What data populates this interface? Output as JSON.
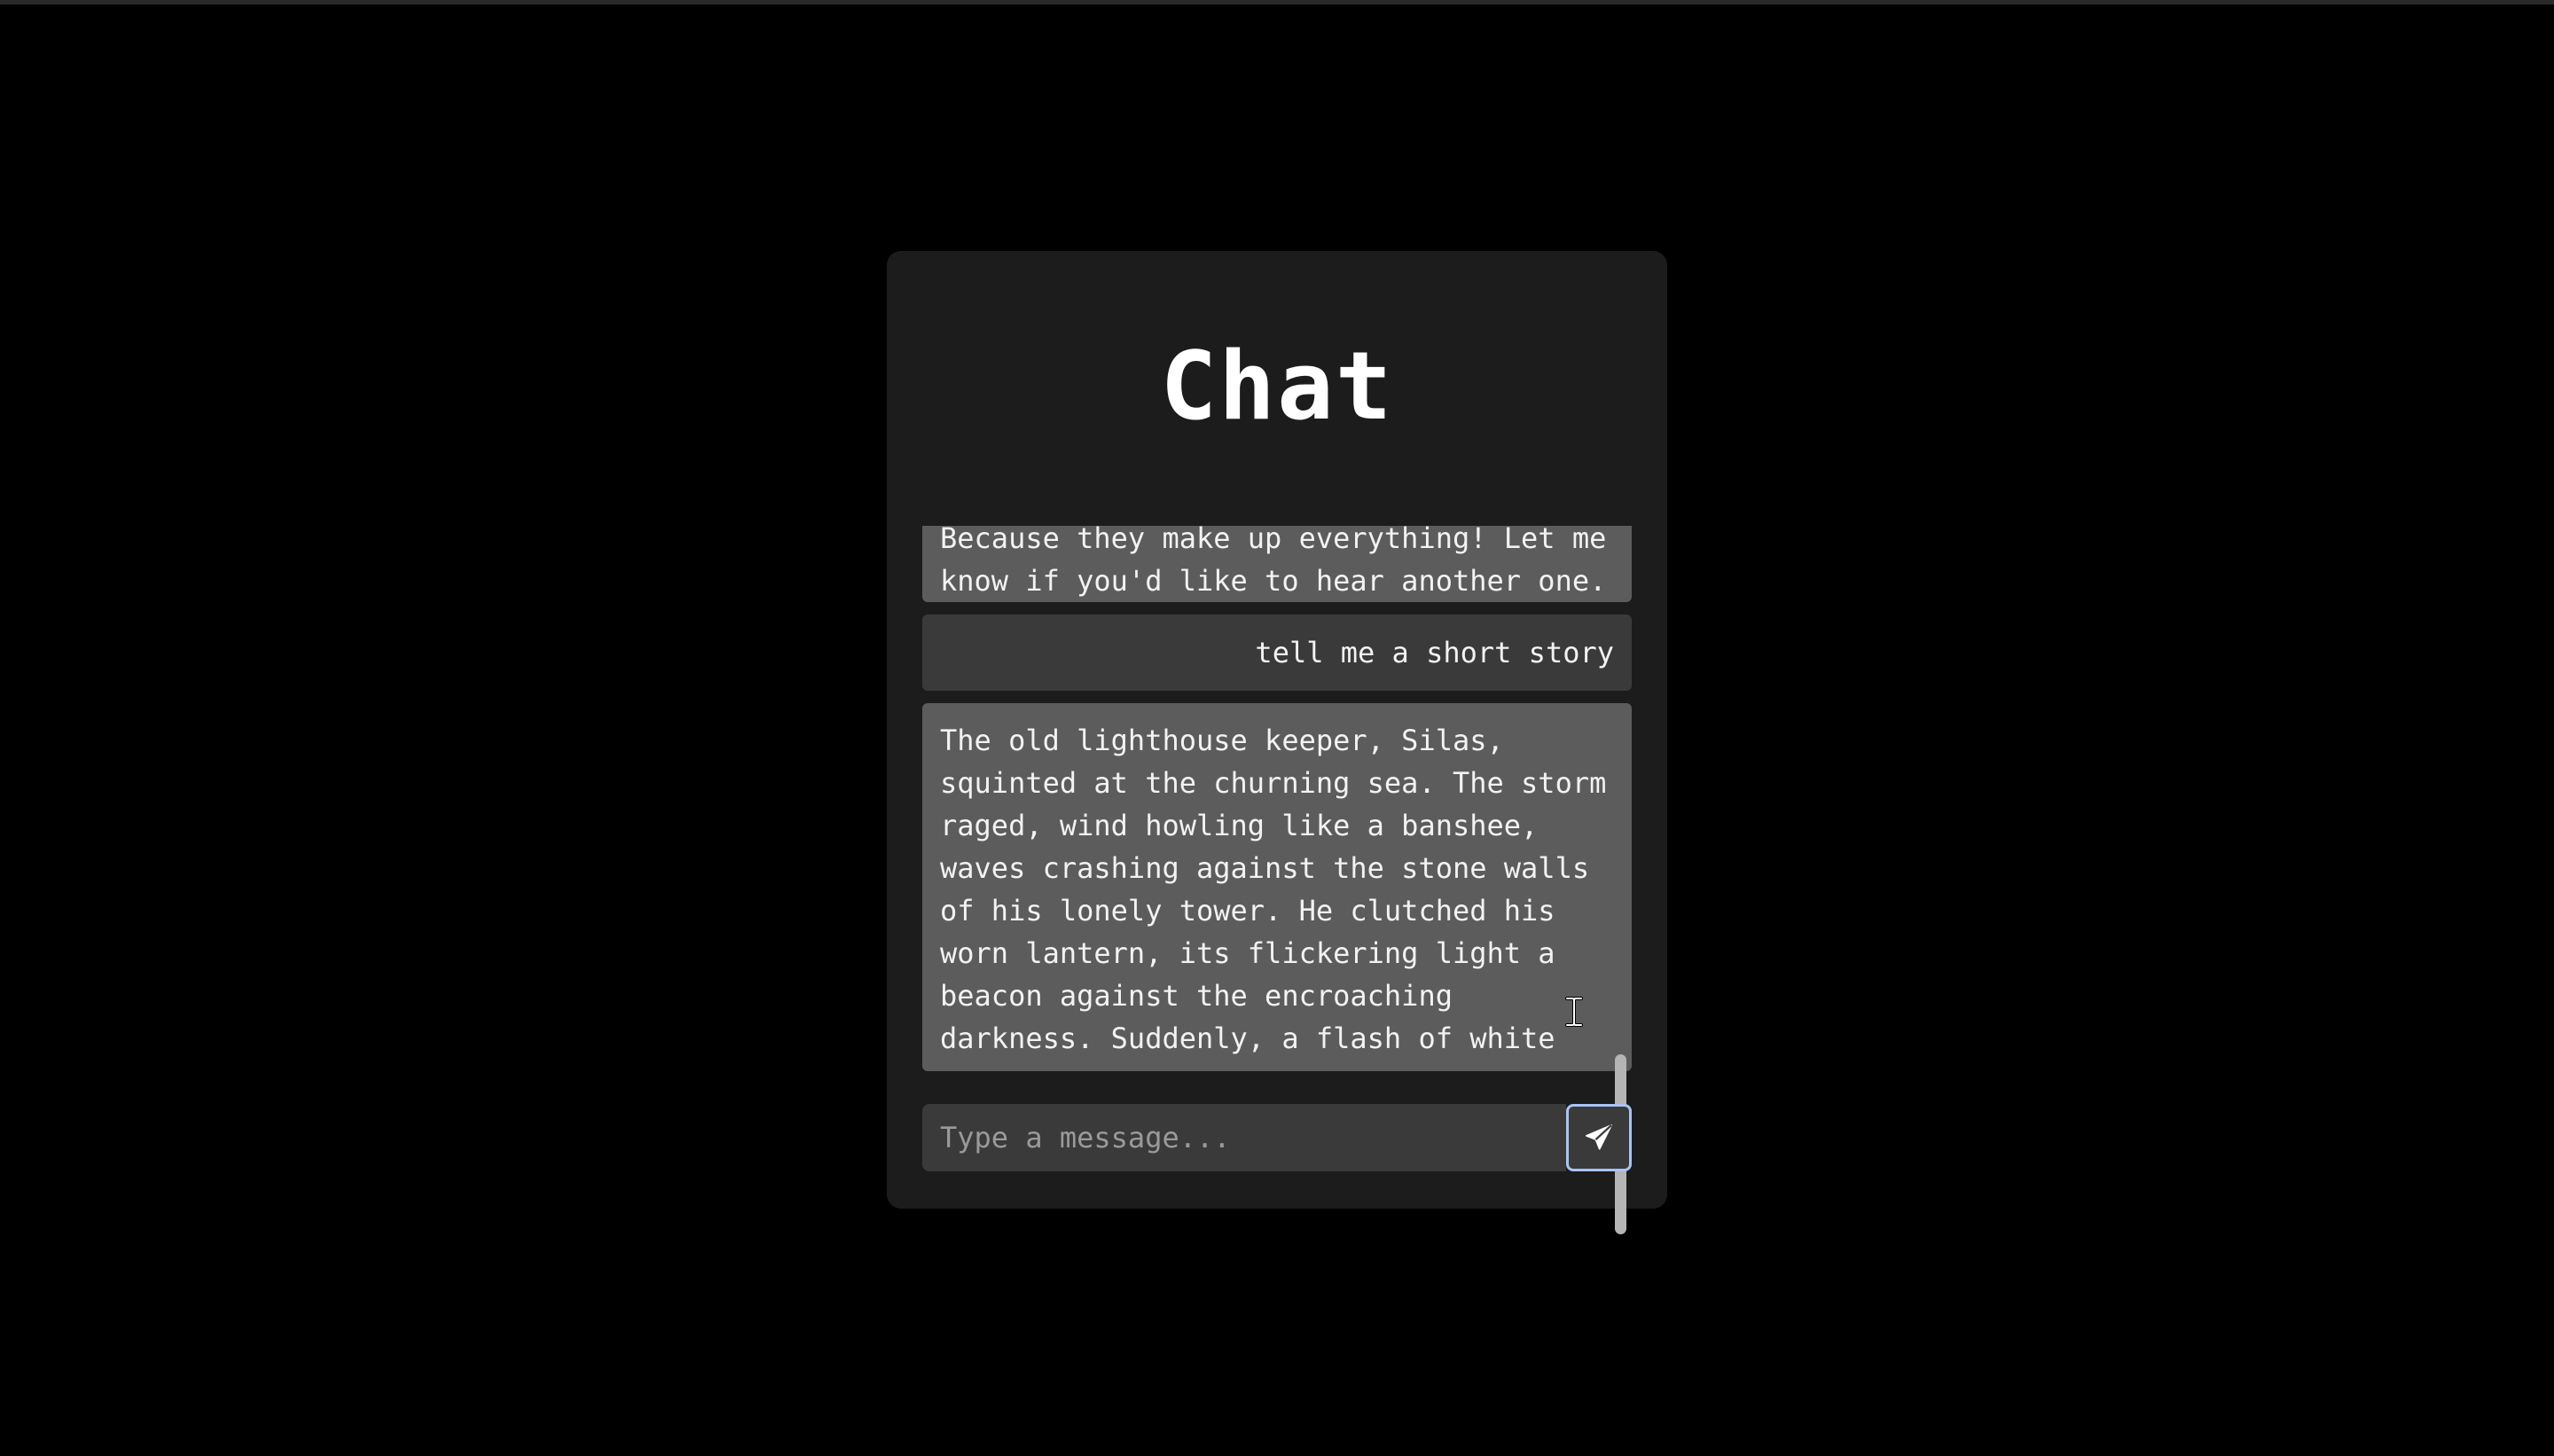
{
  "title": "Chat",
  "messages": [
    {
      "role": "bot",
      "text": "Because they make up everything! Let me\nknow if you'd like to hear another one."
    },
    {
      "role": "user",
      "text": "tell me a short story"
    },
    {
      "role": "bot",
      "text": "The old lighthouse keeper, Silas,\nsquinted at the churning sea. The storm\nraged, wind howling like a banshee,\nwaves crashing against the stone walls\nof his lonely tower. He clutched his\nworn lantern, its flickering light a\nbeacon against the encroaching\ndarkness. Suddenly, a flash of white"
    }
  ],
  "input": {
    "placeholder": "Type a message...",
    "value": ""
  },
  "send": {
    "icon": "paper-plane-icon"
  },
  "colors": {
    "page_background": "#000000",
    "panel_background": "#1c1c1c",
    "bot_bubble": "#5c5c5c",
    "user_bubble": "#3a3a3a",
    "focus_ring": "#a9c4f5"
  }
}
